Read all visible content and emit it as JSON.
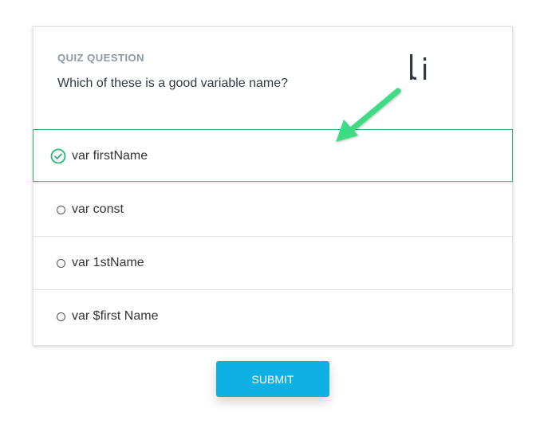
{
  "quiz": {
    "eyebrow": "QUIZ QUESTION",
    "question": "Which of these is a good variable name?",
    "options": [
      {
        "label": "var firstName",
        "selected": true
      },
      {
        "label": "var const",
        "selected": false
      },
      {
        "label": "var 1stName",
        "selected": false
      },
      {
        "label": "var $first Name",
        "selected": false
      }
    ],
    "submit_label": "SUBMIT"
  },
  "logo": {
    "glyph": "li"
  },
  "icons": {
    "selected": "check-circle-icon",
    "unselected": "radio-circle-icon",
    "annotation": "arrow-icon",
    "logo": "logo-icon"
  },
  "colors": {
    "accent_green": "#2db374",
    "arrow_green": "#3ddc84",
    "submit_blue": "#0fb1e4",
    "eyebrow_gray": "#8a98a8",
    "text_dark": "#2f3a45"
  }
}
